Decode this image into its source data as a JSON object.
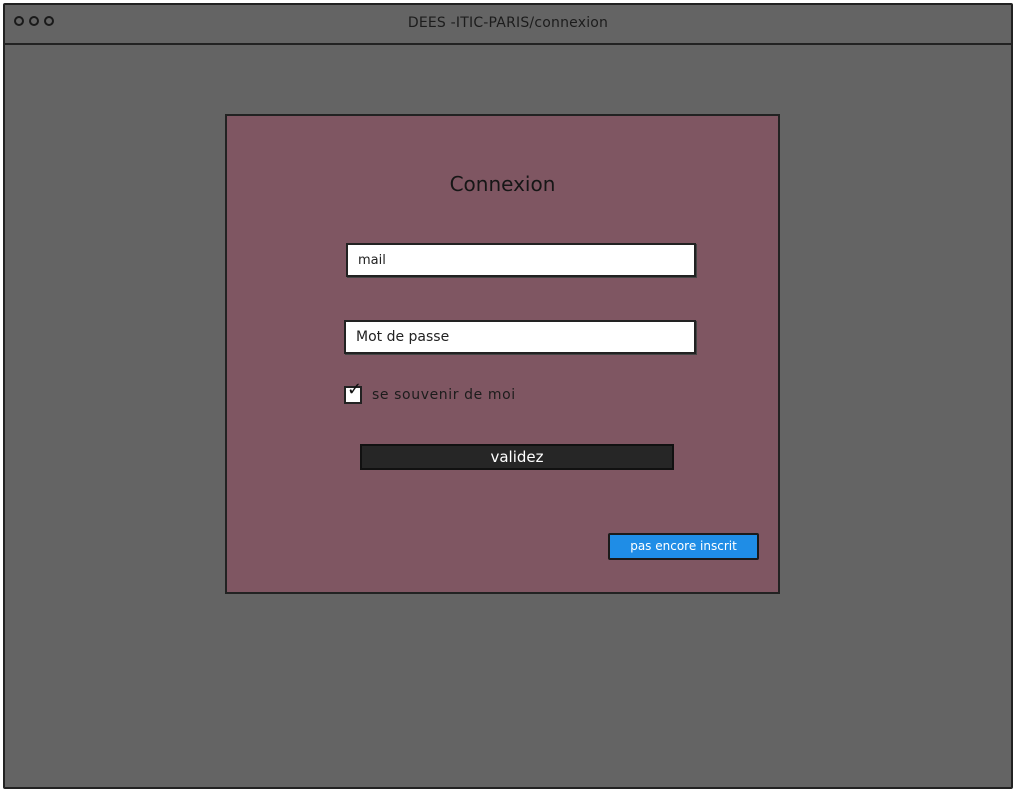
{
  "window": {
    "title": "DEES -ITIC-PARIS/connexion"
  },
  "login": {
    "heading": "Connexion",
    "mail_field": "mail",
    "password_field": "Mot de passe",
    "remember_label": "se souvenir de moi",
    "remember_checked": true,
    "remember_check_glyph": "✓",
    "submit_label": "validez",
    "signup_label": "pas encore inscrit"
  },
  "colors": {
    "background": "#646464",
    "panel": "#7f5662",
    "submit_button": "#262626",
    "signup_button": "#1f8de6"
  },
  "icons": {
    "window_controls": [
      "circle-icon",
      "circle-icon",
      "circle-icon"
    ],
    "checkbox": "check-icon"
  }
}
